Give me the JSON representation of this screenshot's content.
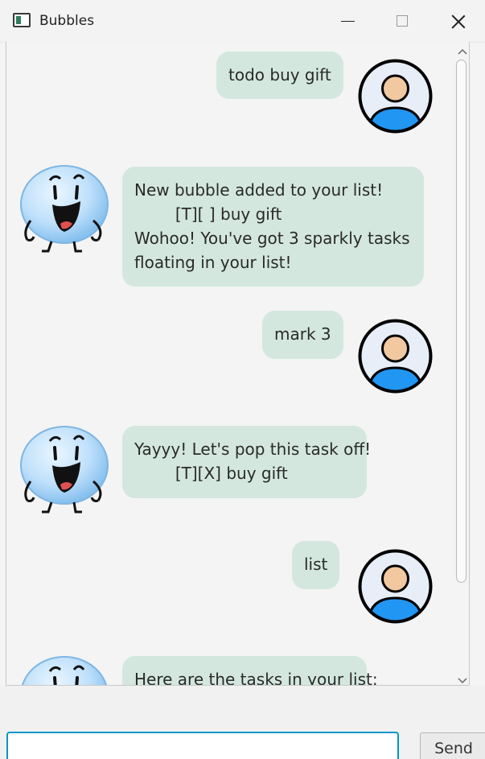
{
  "window": {
    "title": "Bubbles",
    "icon": "app-window-icon"
  },
  "titlebar_controls": [
    "minimize-icon",
    "maximize-icon",
    "close-icon"
  ],
  "messages": [
    {
      "sender": "user",
      "text": "todo buy gift"
    },
    {
      "sender": "bot",
      "text": "New bubble added to your list!\n        [T][ ] buy gift\nWohoo! You've got 3 sparkly tasks\nfloating in your list!"
    },
    {
      "sender": "user",
      "text": "mark 3"
    },
    {
      "sender": "bot",
      "text": "Yayyy! Let's pop this task off!\n        [T][X] buy gift"
    },
    {
      "sender": "user",
      "text": "list"
    },
    {
      "sender": "bot",
      "text": "Here are the tasks in your list:"
    }
  ],
  "input": {
    "value": "",
    "placeholder": ""
  },
  "send_button": {
    "label": "Send"
  },
  "colors": {
    "bubble": "#d3e7de",
    "input_focus": "#0096c9",
    "user_avatar": "#2196f3"
  }
}
